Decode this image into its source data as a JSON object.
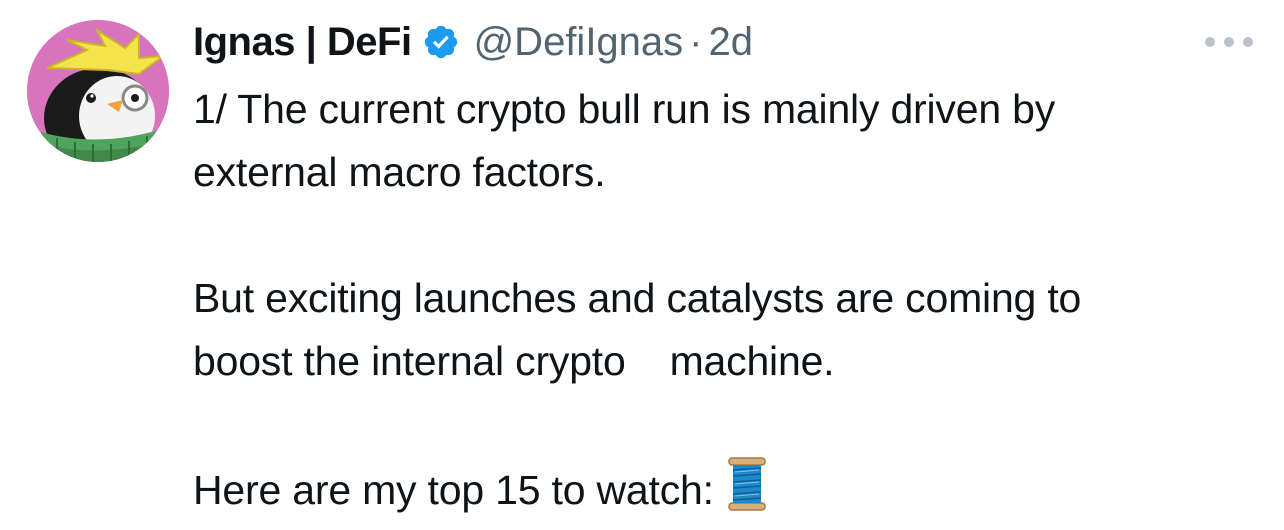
{
  "author": {
    "display_name": "Ignas | DeFi",
    "handle": "@DefiIgnas",
    "separator": "·",
    "time": "2d",
    "verified_icon": "verified-badge-icon"
  },
  "tweet": {
    "lines": [
      "1/ The current crypto bull run is mainly driven by",
      "external macro factors.",
      "But exciting launches and catalysts are coming to",
      "boost the internal crypto",
      "machine.",
      "Here are my top 15 to watch:"
    ],
    "thread_emoji": "spool-of-thread-icon"
  },
  "colors": {
    "text": "#0f1419",
    "secondary": "#536471",
    "verified_blue": "#1d9bf0",
    "avatar_bg": "#d774bd"
  },
  "menu_icon": "more-options-icon"
}
